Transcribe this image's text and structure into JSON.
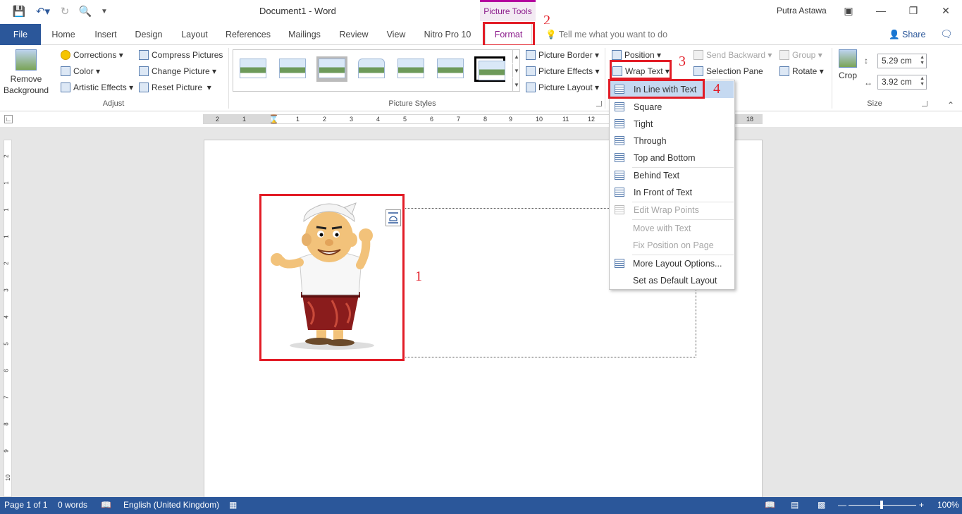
{
  "title_bar": {
    "document_title": "Document1  -  Word",
    "contextual_tab_group": "Picture Tools",
    "user_name": "Putra Astawa"
  },
  "tabs": [
    "File",
    "Home",
    "Insert",
    "Design",
    "Layout",
    "References",
    "Mailings",
    "Review",
    "View",
    "Nitro Pro 10",
    "Format"
  ],
  "tell_me": "Tell me what you want to do",
  "share": "Share",
  "ribbon": {
    "remove_background": "Remove Background",
    "adjust": {
      "label": "Adjust",
      "corrections": "Corrections",
      "color": "Color",
      "artistic_effects": "Artistic Effects",
      "compress_pictures": "Compress Pictures",
      "change_picture": "Change Picture",
      "reset_picture": "Reset Picture"
    },
    "picture_styles": {
      "label": "Picture Styles",
      "picture_border": "Picture Border",
      "picture_effects": "Picture Effects",
      "picture_layout": "Picture Layout"
    },
    "arrange": {
      "position": "Position",
      "wrap_text": "Wrap Text",
      "send_backward": "Send Backward",
      "group": "Group",
      "selection_pane": "Selection Pane",
      "rotate": "Rotate"
    },
    "size": {
      "label": "Size",
      "crop": "Crop",
      "height": "5.29 cm",
      "width": "3.92 cm"
    }
  },
  "ruler_numbers": [
    "2",
    "1",
    "1",
    "2",
    "3",
    "4",
    "5",
    "6",
    "7",
    "8",
    "9",
    "10",
    "11",
    "12",
    "18"
  ],
  "vruler_numbers": [
    "2",
    "1",
    "1",
    "1",
    "2",
    "3",
    "4",
    "5",
    "6",
    "7",
    "8",
    "9",
    "10"
  ],
  "wrap_menu": {
    "items": [
      {
        "label": "In Line with Text",
        "enabled": true,
        "selected": true
      },
      {
        "label": "Square",
        "enabled": true
      },
      {
        "label": "Tight",
        "enabled": true
      },
      {
        "label": "Through",
        "enabled": true
      },
      {
        "label": "Top and Bottom",
        "enabled": true
      },
      {
        "label": "Behind Text",
        "enabled": true
      },
      {
        "label": "In Front of Text",
        "enabled": true
      },
      {
        "label": "Edit Wrap Points",
        "enabled": false
      },
      {
        "label": "Move with Text",
        "enabled": false
      },
      {
        "label": "Fix Position on Page",
        "enabled": false
      },
      {
        "label": "More Layout Options...",
        "enabled": true
      },
      {
        "label": "Set as Default Layout",
        "enabled": true
      }
    ]
  },
  "annotations": [
    "1",
    "2",
    "3",
    "4"
  ],
  "status_bar": {
    "page": "Page 1 of 1",
    "words": "0 words",
    "language": "English (United Kingdom)",
    "zoom": "100%"
  },
  "colors": {
    "word_blue": "#2b579a",
    "picture_tools_accent": "#b4009e",
    "annotation_red": "#e21c26",
    "menu_highlight": "#c5d9f1"
  }
}
